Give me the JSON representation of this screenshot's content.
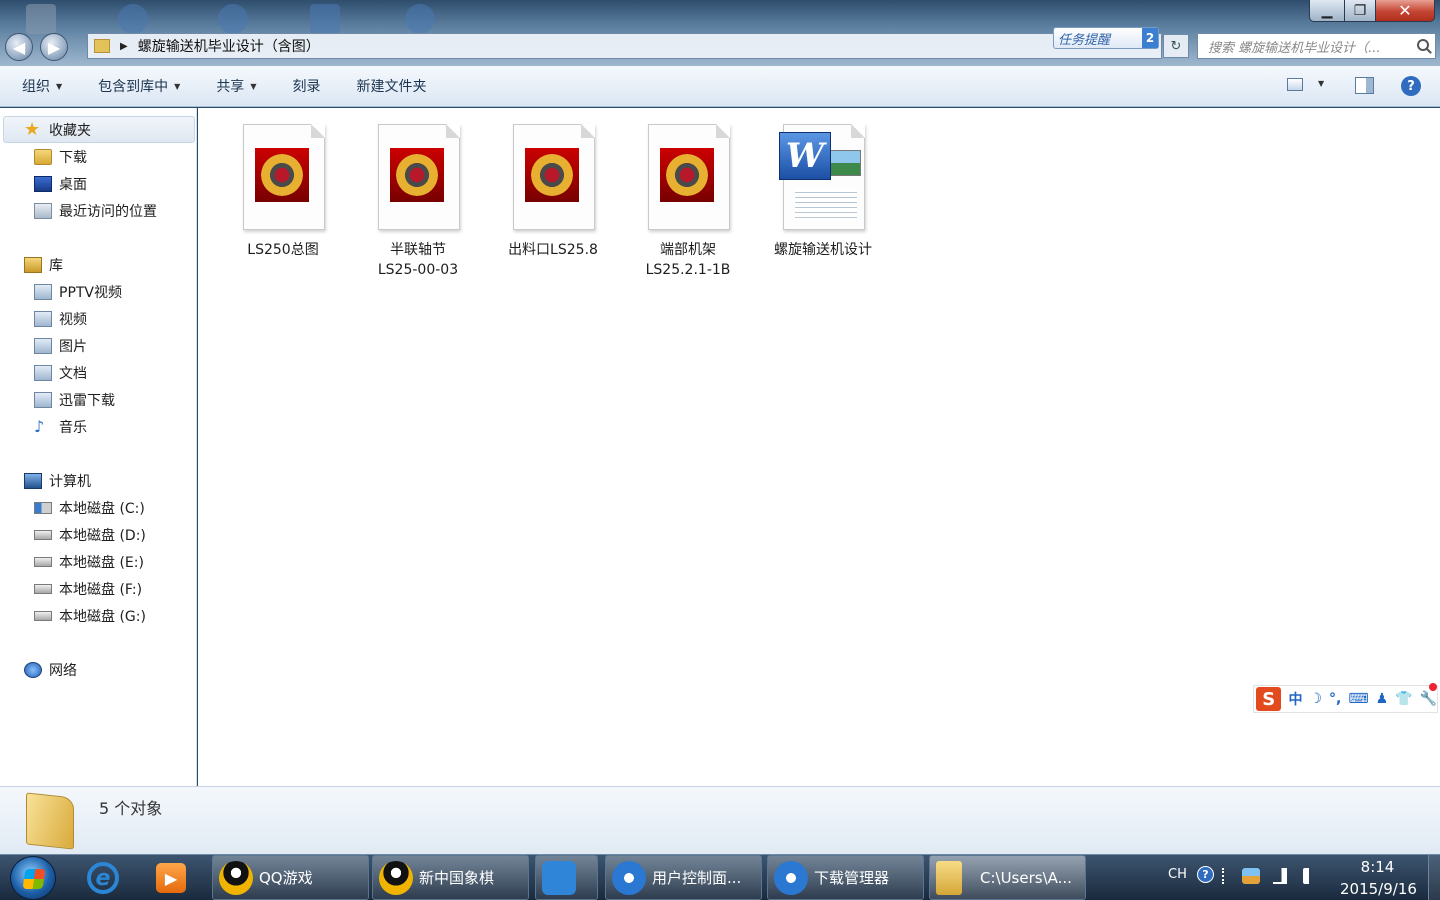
{
  "window": {
    "address_path": "螺旋输送机毕业设计（含图）",
    "task_remind_label": "任务提醒",
    "task_remind_count": "2",
    "search_placeholder": "搜索 螺旋输送机毕业设计（...",
    "minimize_glyph": "▁",
    "maximize_glyph": "❐",
    "close_glyph": "✕",
    "back_glyph": "◀",
    "forward_glyph": "▶",
    "address_arrow": "▶",
    "refresh_glyph": "↻"
  },
  "toolbar": {
    "organize": "组织",
    "include_in_library": "包含到库中",
    "share": "共享",
    "burn": "刻录",
    "new_folder": "新建文件夹",
    "caret": "▼",
    "help": "?"
  },
  "navpane": {
    "favorites": "收藏夹",
    "favorites_items": [
      "下载",
      "桌面",
      "最近访问的位置"
    ],
    "libraries": "库",
    "library_items": [
      "PPTV视频",
      "视频",
      "图片",
      "文档",
      "迅雷下载",
      "音乐"
    ],
    "computer": "计算机",
    "drives": [
      "本地磁盘 (C:)",
      "本地磁盘 (D:)",
      "本地磁盘 (E:)",
      "本地磁盘 (F:)",
      "本地磁盘 (G:)"
    ],
    "network": "网络",
    "star_glyph": "★",
    "music_glyph": "♪"
  },
  "files": [
    {
      "name": "LS250总图",
      "type": "cad"
    },
    {
      "name": "半联轴节\nLS25-00-03",
      "type": "cad"
    },
    {
      "name": "出料口LS25.8",
      "type": "cad"
    },
    {
      "name": "端部机架\nLS25.2.1-1B",
      "type": "cad"
    },
    {
      "name": "螺旋输送机设计",
      "type": "word"
    }
  ],
  "word_glyph": "W",
  "ime": {
    "logo": "S",
    "mode": "中",
    "items": [
      "☽",
      "°,",
      "⌨",
      "♟",
      "👕",
      "🔧"
    ]
  },
  "details": {
    "count_text": "5 个对象"
  },
  "taskbar": {
    "ie_glyph": "e",
    "media_glyph": "▶",
    "tasks": [
      {
        "label": "QQ游戏",
        "icon": "qq-icon"
      },
      {
        "label": "新中国象棋",
        "icon": "qq-icon"
      },
      {
        "label": "",
        "icon": "cloud-icon"
      },
      {
        "label": "用户控制面...",
        "icon": "sogou-icon"
      },
      {
        "label": "下载管理器",
        "icon": "sogou-icon"
      },
      {
        "label": "C:\\Users\\A...",
        "icon": "folder-icon"
      }
    ],
    "tray": {
      "lang": "CH",
      "help": "?",
      "time": "8:14",
      "date": "2015/9/16"
    }
  }
}
